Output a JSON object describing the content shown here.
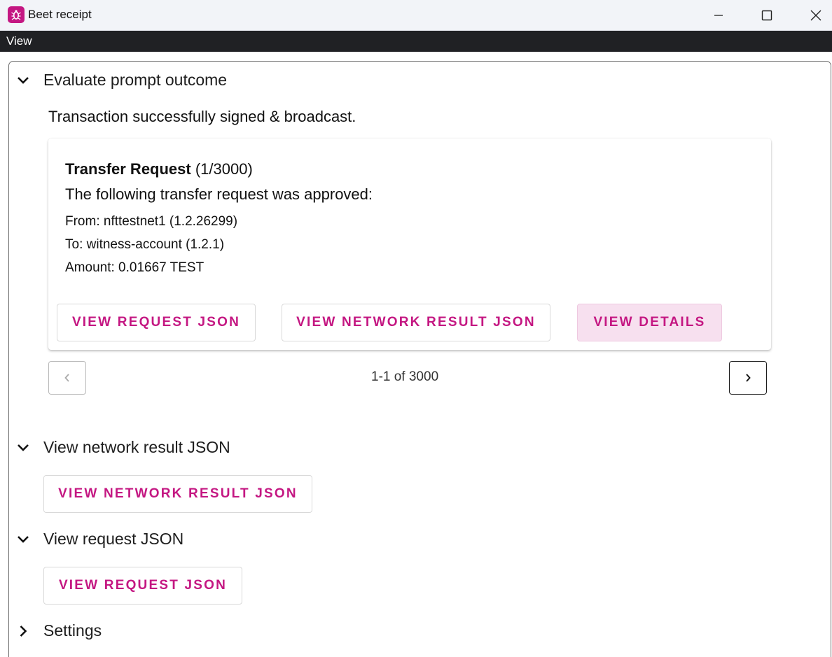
{
  "window": {
    "title": "Beet receipt",
    "app_icon": "beet-logo-icon",
    "controls": [
      "minimize-icon",
      "maximize-icon",
      "close-icon"
    ]
  },
  "menubar": {
    "items": [
      {
        "label": "View"
      }
    ]
  },
  "sections": {
    "evaluate": {
      "title": "Evaluate prompt outcome",
      "expanded": true,
      "status_text": "Transaction successfully signed & broadcast.",
      "card": {
        "title_bold": "Transfer Request",
        "title_count": "(1/3000)",
        "subtitle": "The following transfer request was approved:",
        "from": "From: nfttestnet1 (1.2.26299)",
        "to": "To: witness-account (1.2.1)",
        "amount": "Amount: 0.01667 TEST",
        "buttons": {
          "request_json": "VIEW REQUEST JSON",
          "network_json": "VIEW NETWORK RESULT JSON",
          "details": "VIEW DETAILS"
        }
      },
      "pagination": {
        "text": "1-1 of 3000",
        "prev_enabled": false,
        "next_enabled": true
      }
    },
    "network_result": {
      "title": "View network result JSON",
      "expanded": true,
      "button": "VIEW NETWORK RESULT JSON"
    },
    "request_json": {
      "title": "View request JSON",
      "expanded": true,
      "button": "VIEW REQUEST JSON"
    },
    "settings": {
      "title": "Settings",
      "expanded": false
    }
  },
  "colors": {
    "accent": "#c41782",
    "accent_tonal_bg": "#f7e0ef",
    "menubar_bg": "#202124",
    "titlebar_bg": "#f2f4f8"
  }
}
